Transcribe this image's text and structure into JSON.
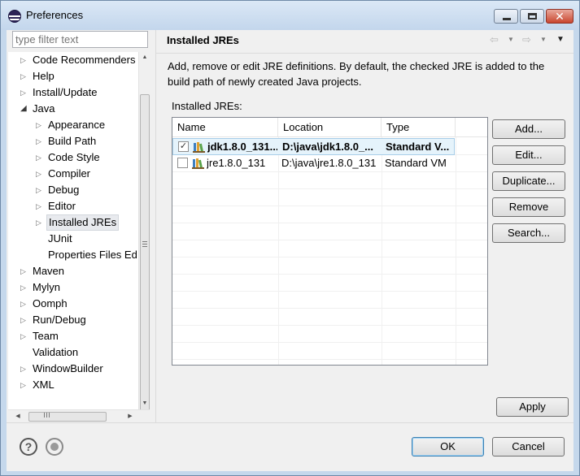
{
  "window": {
    "title": "Preferences",
    "icons": {
      "app": "eclipse-icon",
      "minimize": "minimize-icon",
      "maximize": "maximize-icon",
      "close": "close-icon"
    },
    "close_glyph": "✕"
  },
  "filter": {
    "placeholder": "type filter text",
    "value": ""
  },
  "tree": {
    "items": [
      {
        "label": "Code Recommenders",
        "level": 0,
        "expandable": true,
        "expanded": false
      },
      {
        "label": "Help",
        "level": 0,
        "expandable": true,
        "expanded": false
      },
      {
        "label": "Install/Update",
        "level": 0,
        "expandable": true,
        "expanded": false
      },
      {
        "label": "Java",
        "level": 0,
        "expandable": true,
        "expanded": true
      },
      {
        "label": "Appearance",
        "level": 1,
        "expandable": true,
        "expanded": false
      },
      {
        "label": "Build Path",
        "level": 1,
        "expandable": true,
        "expanded": false
      },
      {
        "label": "Code Style",
        "level": 1,
        "expandable": true,
        "expanded": false
      },
      {
        "label": "Compiler",
        "level": 1,
        "expandable": true,
        "expanded": false
      },
      {
        "label": "Debug",
        "level": 1,
        "expandable": true,
        "expanded": false
      },
      {
        "label": "Editor",
        "level": 1,
        "expandable": true,
        "expanded": false
      },
      {
        "label": "Installed JREs",
        "level": 1,
        "expandable": true,
        "expanded": false,
        "selected": true
      },
      {
        "label": "JUnit",
        "level": 1,
        "expandable": false
      },
      {
        "label": "Properties Files Ed",
        "level": 1,
        "expandable": false
      },
      {
        "label": "Maven",
        "level": 0,
        "expandable": true,
        "expanded": false
      },
      {
        "label": "Mylyn",
        "level": 0,
        "expandable": true,
        "expanded": false
      },
      {
        "label": "Oomph",
        "level": 0,
        "expandable": true,
        "expanded": false
      },
      {
        "label": "Run/Debug",
        "level": 0,
        "expandable": true,
        "expanded": false
      },
      {
        "label": "Team",
        "level": 0,
        "expandable": true,
        "expanded": false
      },
      {
        "label": "Validation",
        "level": 0,
        "expandable": false
      },
      {
        "label": "WindowBuilder",
        "level": 0,
        "expandable": true,
        "expanded": false
      },
      {
        "label": "XML",
        "level": 0,
        "expandable": true,
        "expanded": false
      }
    ],
    "icons": {
      "collapsed": "chevron-right-icon",
      "expanded": "chevron-down-icon"
    }
  },
  "page": {
    "title": "Installed JREs",
    "description": "Add, remove or edit JRE definitions. By default, the checked JRE is added to the build path of newly created Java projects.",
    "list_label": "Installed JREs:",
    "nav_icons": {
      "back": "back-arrow-icon",
      "forward": "forward-arrow-icon",
      "menu": "view-menu-icon"
    }
  },
  "jre_table": {
    "columns": [
      "Name",
      "Location",
      "Type"
    ],
    "rows": [
      {
        "checked": true,
        "name": "jdk1.8.0_131...",
        "location": "D:\\java\\jdk1.8.0_...",
        "type": "Standard V...",
        "icon": "jre-library-icon"
      },
      {
        "checked": false,
        "name": "jre1.8.0_131",
        "location": "D:\\java\\jre1.8.0_131",
        "type": "Standard VM",
        "icon": "jre-library-icon"
      }
    ]
  },
  "buttons": {
    "add": "Add...",
    "edit": "Edit...",
    "duplicate": "Duplicate...",
    "remove": "Remove",
    "search": "Search...",
    "apply": "Apply",
    "ok": "OK",
    "cancel": "Cancel"
  },
  "footer_icons": {
    "help": "help-icon",
    "record": "record-icon"
  },
  "colors": {
    "selection_bg": "#e5f3fb",
    "selection_border": "#a8cde8",
    "titlebar": "#c5d8ec",
    "close_button": "#c9462f"
  }
}
